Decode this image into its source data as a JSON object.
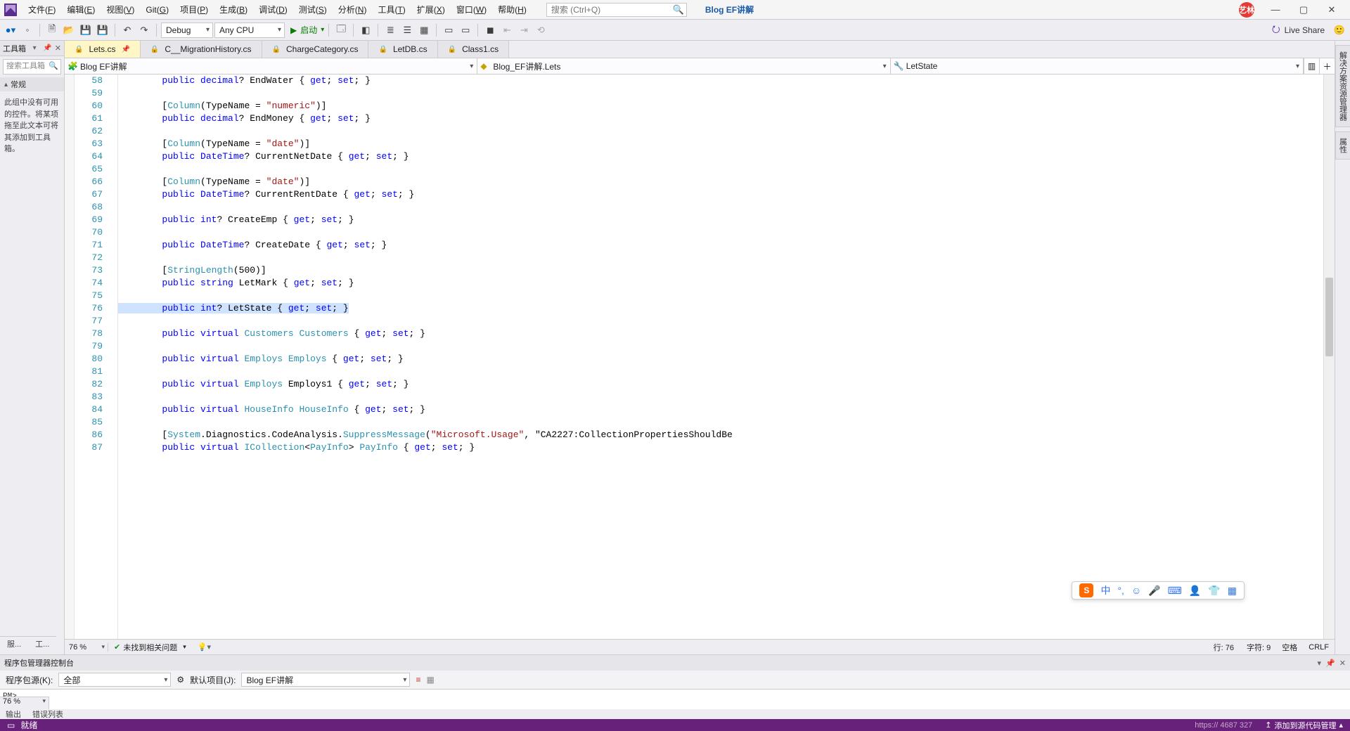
{
  "menu": {
    "items": [
      {
        "l": "文件",
        "u": "F"
      },
      {
        "l": "编辑",
        "u": "E"
      },
      {
        "l": "视图",
        "u": "V"
      },
      {
        "l": "Git",
        "u": "G"
      },
      {
        "l": "项目",
        "u": "P"
      },
      {
        "l": "生成",
        "u": "B"
      },
      {
        "l": "调试",
        "u": "D"
      },
      {
        "l": "测试",
        "u": "S"
      },
      {
        "l": "分析",
        "u": "N"
      },
      {
        "l": "工具",
        "u": "T"
      },
      {
        "l": "扩展",
        "u": "X"
      },
      {
        "l": "窗口",
        "u": "W"
      },
      {
        "l": "帮助",
        "u": "H"
      }
    ]
  },
  "title": {
    "search_placeholder": "搜索 (Ctrl+Q)",
    "solution": "Blog EF讲解",
    "avatar": "艺林"
  },
  "toolbar": {
    "config": "Debug",
    "platform": "Any CPU",
    "start": "启动",
    "liveshare": "Live Share"
  },
  "toolbox": {
    "title": "工具箱",
    "search": "搜索工具箱",
    "group": "常规",
    "msg": "此组中没有可用的控件。将某项拖至此文本可将其添加到工具箱。"
  },
  "tabs": [
    {
      "label": "Lets.cs",
      "active": true,
      "pinned": true
    },
    {
      "label": "C__MigrationHistory.cs"
    },
    {
      "label": "ChargeCategory.cs"
    },
    {
      "label": "LetDB.cs"
    },
    {
      "label": "Class1.cs"
    }
  ],
  "nav": {
    "project": "Blog EF讲解",
    "class": "Blog_EF讲解.Lets",
    "member": "LetState"
  },
  "code": {
    "first_line": 58,
    "lines": [
      "        public decimal? EndWater { get; set; }",
      "",
      "        [Column(TypeName = \"numeric\")]",
      "        public decimal? EndMoney { get; set; }",
      "",
      "        [Column(TypeName = \"date\")]",
      "        public DateTime? CurrentNetDate { get; set; }",
      "",
      "        [Column(TypeName = \"date\")]",
      "        public DateTime? CurrentRentDate { get; set; }",
      "",
      "        public int? CreateEmp { get; set; }",
      "",
      "        public DateTime? CreateDate { get; set; }",
      "",
      "        [StringLength(500)]",
      "        public string LetMark { get; set; }",
      "",
      "        public int? LetState { get; set; }",
      "",
      "        public virtual Customers Customers { get; set; }",
      "",
      "        public virtual Employs Employs { get; set; }",
      "",
      "        public virtual Employs Employs1 { get; set; }",
      "",
      "        public virtual HouseInfo HouseInfo { get; set; }",
      "",
      "        [System.Diagnostics.CodeAnalysis.SuppressMessage(\"Microsoft.Usage\", \"CA2227:CollectionPropertiesShouldBe",
      "        public virtual ICollection<PayInfo> PayInfo { get; set; }"
    ],
    "selected_line_index": 18
  },
  "editor_foot": {
    "zoom": "76 %",
    "issues": "未找到相关问题",
    "line": "行: 76",
    "char": "字符: 9",
    "ins": "空格",
    "eol": "CRLF"
  },
  "left_bottom": {
    "a": "服...",
    "b": "工..."
  },
  "pmc": {
    "title": "程序包管理器控制台",
    "src_label": "程序包源(K):",
    "src_value": "全部",
    "proj_label": "默认项目(J):",
    "proj_value": "Blog EF讲解",
    "prompt": "PM>",
    "zoom": "76 %"
  },
  "bottom_tabs": {
    "a": "输出",
    "b": "错误列表"
  },
  "status": {
    "ready": "就绪",
    "src": "添加到源代码管理"
  },
  "ime": {
    "lang": "中"
  },
  "watermark": "https://    4687 327"
}
